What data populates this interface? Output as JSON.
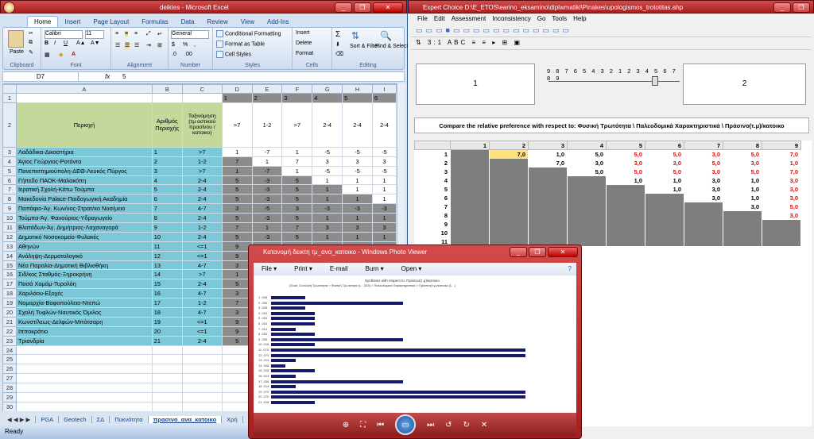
{
  "excel": {
    "title": "deiktes - Microsoft Excel",
    "tabs": [
      "Home",
      "Insert",
      "Page Layout",
      "Formulas",
      "Data",
      "Review",
      "View",
      "Add-Ins"
    ],
    "ribbon": {
      "paste": "Paste",
      "clipboard": "Clipboard",
      "font_name": "Calibri",
      "font_size": "11",
      "font": "Font",
      "alignment": "Alignment",
      "number_format": "General",
      "number": "Number",
      "cond_fmt": "Conditional Formatting",
      "fmt_table": "Format as Table",
      "cell_styles": "Cell Styles",
      "styles": "Styles",
      "insert": "Insert",
      "delete": "Delete",
      "format": "Format",
      "cells": "Cells",
      "sort": "Sort & Filter",
      "find": "Find & Select",
      "editing": "Editing"
    },
    "name_box": "D7",
    "formula": "5",
    "col_headers": [
      "A",
      "B",
      "C",
      "D",
      "E",
      "F",
      "G",
      "H",
      "I"
    ],
    "header_row": {
      "area": "Περιοχή",
      "num": "Αριθμός Περιοχής",
      "cls": "Ταξινόμηση (τμ αστικού πρασίνου /κατοικο)",
      "d": ">7",
      "e": "1-2",
      "f": ">7",
      "g": "2-4",
      "h": "2-4",
      "i": "2-4"
    },
    "top_row": [
      "1",
      "2",
      "3",
      "4",
      "5",
      "6"
    ],
    "rows": [
      [
        "Λαδάδικα-Δικαστήρια",
        "1",
        ">7",
        "1",
        "-7",
        "1",
        "-5",
        "-5",
        "-5"
      ],
      [
        "Άγιος Γεώργιος-Ροτόντα",
        "2",
        "1-2",
        "7",
        "1",
        "7",
        "3",
        "3",
        "3"
      ],
      [
        "Πανεπιστημιούπολη-ΔΕΘ-Λευκός Πύργος",
        "3",
        ">7",
        "1",
        "-7",
        "1",
        "-5",
        "-5",
        "-5"
      ],
      [
        "Γήπεδο ΠΑΟΚ-Μαλακόπη",
        "4",
        "2-4",
        "5",
        "-3",
        "5",
        "1",
        "1",
        "1"
      ],
      [
        "Ιερατική Σχολή-Κάτω Τούμπα",
        "5",
        "2-4",
        "5",
        "-3",
        "5",
        "1",
        "1",
        "1"
      ],
      [
        "Μακεδονία Palace-Παιδαγωγική Ακαδημία",
        "6",
        "2-4",
        "5",
        "-3",
        "5",
        "1",
        "1",
        "1"
      ],
      [
        "Παπάφιο-Άγ. Κων/νος-Στρατ/κο Νοσ/μειο",
        "7",
        "4-7",
        "3",
        "-5",
        "3",
        "-3",
        "-3",
        "-3"
      ],
      [
        "Τούμπα-Άγ. Φανούριος-Υδραγωγείο",
        "8",
        "2-4",
        "5",
        "-3",
        "5",
        "1",
        "1",
        "1"
      ],
      [
        "Βλατάδων-Άγ. Δημήτριος-Λαχαναγορά",
        "9",
        "1-2",
        "7",
        "1",
        "7",
        "3",
        "3",
        "3"
      ],
      [
        "Δημοτικό Νοσοκομείο-Φυλακές",
        "10",
        "2-4",
        "5",
        "-3",
        "5",
        "1",
        "1",
        "1"
      ],
      [
        "Αθηνών",
        "11",
        "<=1",
        "9",
        "3",
        "9",
        "5",
        "5",
        "5"
      ],
      [
        "Ανάληψη-Δερματολογικό",
        "12",
        "<=1",
        "9",
        "",
        "",
        "",
        "",
        ""
      ],
      [
        "Νέα Παραλία-Δημοτική Βιβλιοθήκη",
        "13",
        "4-7",
        "3",
        "",
        "",
        "",
        "",
        ""
      ],
      [
        "Σιδ/κος Σταθμός-Ξηροκρήνη",
        "14",
        ">7",
        "1",
        "",
        "",
        "",
        "",
        ""
      ],
      [
        "Πασά Χαμάμ-Τυρολόη",
        "15",
        "2-4",
        "5",
        "",
        "",
        "",
        "",
        ""
      ],
      [
        "Χαριλάου-Εξοχές",
        "16",
        "4-7",
        "3",
        "",
        "",
        "",
        "",
        ""
      ],
      [
        "Νομαρχία-Βαφοπούλειο-Ντεπώ",
        "17",
        "1-2",
        "7",
        "",
        "",
        "",
        "",
        ""
      ],
      [
        "Σχολή Τυφλών-Ναυτικός Όμιλος",
        "18",
        "4-7",
        "3",
        "",
        "",
        "",
        "",
        ""
      ],
      [
        "Κωνστ/λεως-Δελφών-Μπότσαρη",
        "19",
        "<=1",
        "9",
        "",
        "",
        "",
        "",
        ""
      ],
      [
        "Ιπποκράτιο",
        "20",
        "<=1",
        "9",
        "",
        "",
        "",
        "",
        ""
      ],
      [
        "Τριανδρία",
        "21",
        "2-4",
        "5",
        "",
        "",
        "",
        "",
        ""
      ]
    ],
    "sheet_tabs": [
      "PGA",
      "Geotech",
      "ΣΔ",
      "Πυκνότητα",
      "πρασινο_ανα_κατοικο",
      "Χρή"
    ],
    "status": "Ready"
  },
  "ec": {
    "title": "Expert Choice    D:\\E_ETOS\\earino_eksamino\\diplwmatiki\\Pinakes\\upologismos_trototitas.ahp",
    "menu": [
      "File",
      "Edit",
      "Assessment",
      "Inconsistency",
      "Go",
      "Tools",
      "Help"
    ],
    "left_node": "1",
    "right_node": "2",
    "scale": "9 8 7 6 5 4 3 2 1 2 3 4 5 6 7 8 9",
    "compare": "Compare the relative preference with respect to: Φυσική Τρωτότητα  \\ Παλεοδομικά Χαρακτηριστικά  \\ Πράσινο(τ.μ)/κατοικο",
    "col_headers": [
      "1",
      "2",
      "3",
      "4",
      "5",
      "6",
      "7",
      "8",
      "9"
    ],
    "rows": [
      [
        "1",
        [
          "7,0",
          "1,0",
          "5,0",
          "5,0",
          "5,0",
          "3,0",
          "5,0",
          "7,0"
        ]
      ],
      [
        "2",
        [
          "",
          "7,0",
          "3,0",
          "3,0",
          "3,0",
          "5,0",
          "3,0",
          "1,0"
        ]
      ],
      [
        "3",
        [
          "",
          "",
          "5,0",
          "5,0",
          "5,0",
          "3,0",
          "5,0",
          "7,0"
        ]
      ],
      [
        "4",
        [
          "",
          "",
          "",
          "1,0",
          "1,0",
          "3,0",
          "1,0",
          "3,0"
        ]
      ],
      [
        "5",
        [
          "",
          "",
          "",
          "",
          "1,0",
          "3,0",
          "1,0",
          "3,0"
        ]
      ],
      [
        "6",
        [
          "",
          "",
          "",
          "",
          "",
          "3,0",
          "1,0",
          "3,0"
        ]
      ],
      [
        "7",
        [
          "",
          "",
          "",
          "",
          "",
          "",
          "3,0",
          "5,0"
        ]
      ],
      [
        "8",
        [
          "",
          "",
          "",
          "",
          "",
          "",
          "",
          "3,0"
        ]
      ],
      [
        "9",
        [
          "",
          "",
          "",
          "",
          "",
          "",
          "",
          ""
        ]
      ],
      [
        "10",
        [
          "",
          "",
          "",
          "",
          "",
          "",
          "",
          ""
        ]
      ],
      [
        "11",
        [
          "",
          "",
          "",
          "",
          "",
          "",
          "",
          ""
        ]
      ]
    ]
  },
  "pv": {
    "title": "Κατανομή δεικτη τμ_ανα_κατοικο - Windows Photo Viewer",
    "menu": [
      "File ▾",
      "Print ▾",
      "E-mail",
      "Burn ▾",
      "Open ▾"
    ],
    "img_title": "Synthesis with respect to: Πράσινο(τ.μ)/κατοικο",
    "img_sub": "(Goal: Συνολική Τρωτότητα > Φυσική Τρωτότητα (L: .333) > Παλεοδομικά Χαρακτηριστικά > Πράσινο(τ.μ)/κατοικο (L: .)",
    "bar_values": [
      0.07,
      0.27,
      0.07,
      0.09,
      0.09,
      0.09,
      0.05,
      0.09,
      0.27,
      0.09,
      0.52,
      0.52,
      0.05,
      0.03,
      0.09,
      0.05,
      0.27,
      0.05,
      0.52,
      0.52,
      0.09
    ],
    "bar_labels": [
      "1 .008",
      "2 .036",
      "3 .008",
      "4 .016",
      "5 .016",
      "6 .016",
      "7 .014",
      "8 .016",
      "9 .036",
      "10 .016",
      "11 .070",
      "12 .070",
      "13 .014",
      "14 .008",
      "15 .016",
      "16 .014",
      "17 .036",
      "18 .014",
      "19 .070",
      "20 .070",
      "21 .016"
    ]
  }
}
